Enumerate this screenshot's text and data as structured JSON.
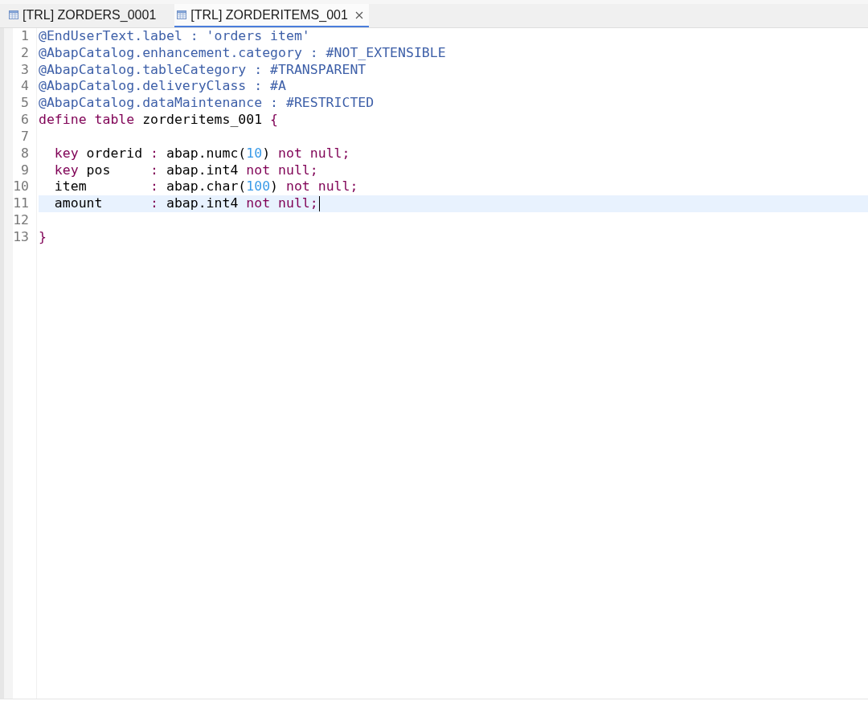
{
  "tabs": [
    {
      "label": "[TRL] ZORDERS_0001",
      "selected": false,
      "closable": false
    },
    {
      "label": "[TRL] ZORDERITEMS_001",
      "selected": true,
      "closable": true
    }
  ],
  "editor": {
    "lines": [
      {
        "number": "1",
        "current": false,
        "cursor": false,
        "tokens": [
          {
            "kind": "annotation",
            "text": "@EndUserText.label : 'orders item'"
          }
        ]
      },
      {
        "number": "2",
        "current": false,
        "cursor": false,
        "tokens": [
          {
            "kind": "annotation",
            "text": "@AbapCatalog.enhancement.category : #NOT_EXTENSIBLE"
          }
        ]
      },
      {
        "number": "3",
        "current": false,
        "cursor": false,
        "tokens": [
          {
            "kind": "annotation",
            "text": "@AbapCatalog.tableCategory : #TRANSPARENT"
          }
        ]
      },
      {
        "number": "4",
        "current": false,
        "cursor": false,
        "tokens": [
          {
            "kind": "annotation",
            "text": "@AbapCatalog.deliveryClass : #A"
          }
        ]
      },
      {
        "number": "5",
        "current": false,
        "cursor": false,
        "tokens": [
          {
            "kind": "annotation",
            "text": "@AbapCatalog.dataMaintenance : #RESTRICTED"
          }
        ]
      },
      {
        "number": "6",
        "current": false,
        "cursor": false,
        "tokens": [
          {
            "kind": "keyword",
            "text": "define table"
          },
          {
            "kind": "plain",
            "text": " zorderitems_001 "
          },
          {
            "kind": "keyword",
            "text": "{"
          }
        ]
      },
      {
        "number": "7",
        "current": false,
        "cursor": false
      },
      {
        "number": "8",
        "current": false,
        "cursor": false,
        "tokens": [
          {
            "kind": "keyword",
            "text": "  key"
          },
          {
            "kind": "plain",
            "text": " orderid "
          },
          {
            "kind": "keyword",
            "text": ":"
          },
          {
            "kind": "plain",
            "text": " abap.numc("
          },
          {
            "kind": "number",
            "text": "10"
          },
          {
            "kind": "plain",
            "text": ") "
          },
          {
            "kind": "keyword",
            "text": "not null;"
          }
        ]
      },
      {
        "number": "9",
        "current": false,
        "cursor": false,
        "tokens": [
          {
            "kind": "keyword",
            "text": "  key"
          },
          {
            "kind": "plain",
            "text": " pos     "
          },
          {
            "kind": "keyword",
            "text": ":"
          },
          {
            "kind": "plain",
            "text": " abap.int4 "
          },
          {
            "kind": "keyword",
            "text": "not null;"
          }
        ]
      },
      {
        "number": "10",
        "current": false,
        "cursor": false,
        "tokens": [
          {
            "kind": "plain",
            "text": "  item        "
          },
          {
            "kind": "keyword",
            "text": ":"
          },
          {
            "kind": "plain",
            "text": " abap.char("
          },
          {
            "kind": "number",
            "text": "100"
          },
          {
            "kind": "plain",
            "text": ") "
          },
          {
            "kind": "keyword",
            "text": "not null;"
          }
        ]
      },
      {
        "number": "11",
        "current": true,
        "cursor": true,
        "tokens": [
          {
            "kind": "plain",
            "text": "  amount      "
          },
          {
            "kind": "keyword",
            "text": ":"
          },
          {
            "kind": "plain",
            "text": " abap.int4 "
          },
          {
            "kind": "keyword",
            "text": "not null;"
          }
        ]
      },
      {
        "number": "12",
        "current": false,
        "cursor": false
      },
      {
        "number": "13",
        "current": false,
        "cursor": false,
        "tokens": [
          {
            "kind": "keyword",
            "text": "}"
          }
        ]
      }
    ]
  }
}
